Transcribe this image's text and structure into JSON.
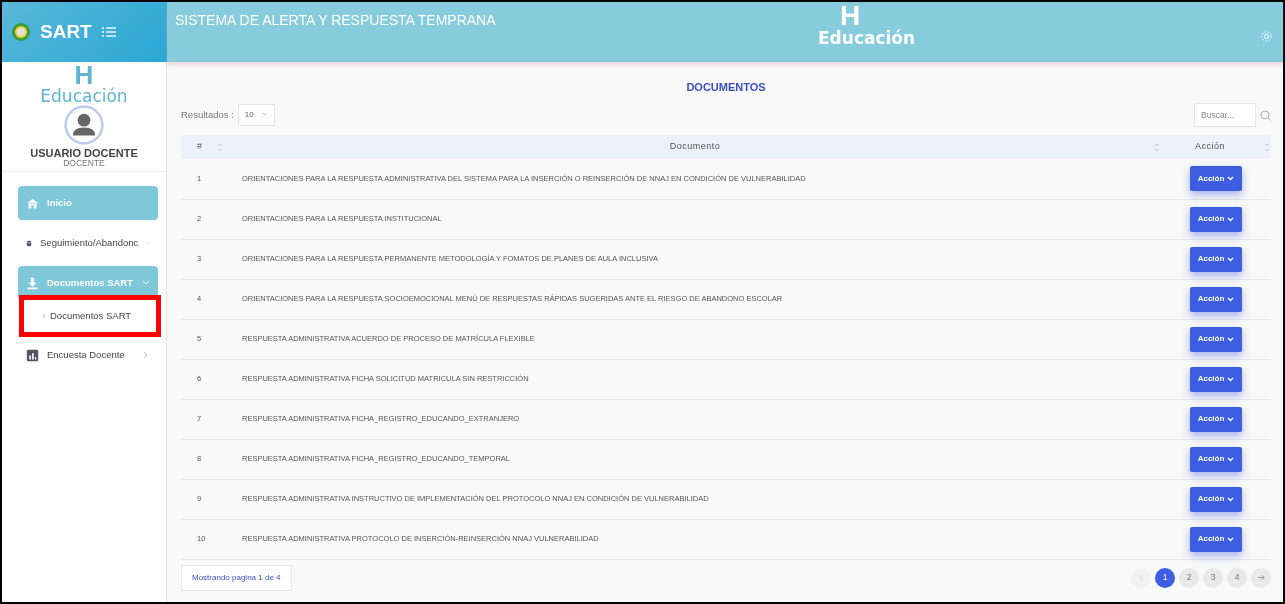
{
  "brand": {
    "name": "SART"
  },
  "header": {
    "title": "SISTEMA DE ALERTA Y RESPUESTA TEMPRANA",
    "logo_mark": "H",
    "logo_text": "Educación"
  },
  "sidebar": {
    "logo_mark": "H",
    "logo_text": "Educación",
    "user_name": "USUARIO DOCENTE",
    "user_role": "DOCENTE",
    "items": [
      {
        "label": "Inicio",
        "kind": "leaf",
        "selected": true,
        "expanded": false
      },
      {
        "label": "Seguimiento/Abandonc",
        "kind": "group",
        "selected": false,
        "expanded": false
      },
      {
        "label": "Documentos SART",
        "kind": "group",
        "selected": true,
        "expanded": true,
        "children": [
          {
            "label": "Documentos SART",
            "highlighted": true
          }
        ]
      },
      {
        "label": "Encuesta Docente",
        "kind": "group",
        "selected": false,
        "expanded": false
      }
    ]
  },
  "page": {
    "title": "DOCUMENTOS",
    "results_label": "Resultados :",
    "results_value": "10",
    "search_placeholder": "Buscar..."
  },
  "table": {
    "columns": [
      "#",
      "Documento",
      "Acción"
    ],
    "rows": [
      {
        "num": "1",
        "document": "ORIENTACIONES PARA LA RESPUESTA ADMINISTRATIVA DEL SISTEMA PARA LA INSERCIÓN O REINSERCIÓN DE NNAJ EN CONDICIÓN DE VULNERABILIDAD",
        "action": "Acción"
      },
      {
        "num": "2",
        "document": "ORIENTACIONES PARA LA RESPUESTA INSTITUCIONAL",
        "action": "Acción"
      },
      {
        "num": "3",
        "document": "ORIENTACIONES PARA LA RESPUESTA PERMANENTE METODOLOGÍA Y FOMATOS DE PLANES DE AULA INCLUSIVA",
        "action": "Acción"
      },
      {
        "num": "4",
        "document": "ORIENTACIONES PARA LA RESPUESTA SOCIOEMOCIONAL MENÚ DE RESPUESTAS RÁPIDAS SUGERIDAS ANTE EL RIESGO DE ABANDONO ESCOLAR",
        "action": "Acción"
      },
      {
        "num": "5",
        "document": "RESPUESTA ADMINISTRATIVA ACUERDO DE PROCESO DE MATRÍCULA FLEXIBLE",
        "action": "Acción"
      },
      {
        "num": "6",
        "document": "RESPUESTA ADMINISTRATIVA FICHA SOLICITUD MATRICULA SIN RESTRICCIÓN",
        "action": "Acción"
      },
      {
        "num": "7",
        "document": "RESPUESTA ADMINISTRATIVA FICHA_REGISTRO_EDUCANDO_EXTRANJERO",
        "action": "Acción"
      },
      {
        "num": "8",
        "document": "RESPUESTA ADMINISTRATIVA FICHA_REGISTRO_EDUCANDO_TEMPORAL",
        "action": "Acción"
      },
      {
        "num": "9",
        "document": "RESPUESTA ADMINISTRATIVA INSTRUCTIVO DE IMPLEMENTACIÓN DEL PROTOCOLO NNAJ EN CONDICIÓN DE VULNERABILIDAD",
        "action": "Acción"
      },
      {
        "num": "10",
        "document": "RESPUESTA ADMINISTRATIVA PROTOCOLO DE INSERCIÓN-REINSERCIÓN NNAJ VULNERABILIDAD",
        "action": "Acción"
      }
    ]
  },
  "footer": {
    "info": "Mostrando pagina 1 de 4",
    "prev_disabled": true,
    "pages": [
      {
        "label": "1",
        "selected": true
      },
      {
        "label": "2",
        "selected": false
      },
      {
        "label": "3",
        "selected": false
      },
      {
        "label": "4",
        "selected": false
      }
    ]
  }
}
